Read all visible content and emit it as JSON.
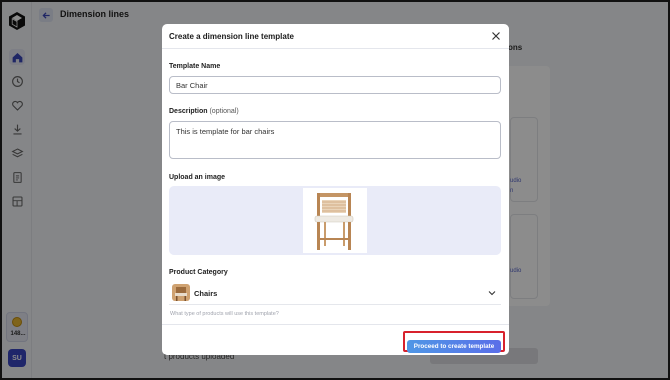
{
  "app": {
    "page_title": "Dimension lines",
    "credits_count": "148...",
    "user_initials": "SU"
  },
  "sidebar": {
    "items": [
      {
        "icon": "home-icon",
        "active": true
      },
      {
        "icon": "clock-icon",
        "active": false
      },
      {
        "icon": "heart-icon",
        "active": false
      },
      {
        "icon": "download-icon",
        "active": false
      },
      {
        "icon": "layers-icon",
        "active": false
      },
      {
        "icon": "document-icon",
        "active": false
      },
      {
        "icon": "grid-icon",
        "active": false
      }
    ]
  },
  "background": {
    "heading_fragment": "ons",
    "link_fragment_1": "udio",
    "link_fragment_2": "n",
    "link_fragment_3": "udio",
    "footer_text_fragment": "t products uploaded"
  },
  "modal": {
    "title": "Create a dimension line template",
    "template_name_label": "Template Name",
    "template_name_value": "Bar Chair",
    "description_label": "Description",
    "description_optional": "(optional)",
    "description_value": "This is template for bar chairs",
    "upload_label": "Upload an image",
    "category_label": "Product Category",
    "category_value": "Chairs",
    "category_help": "What type of products will use this template?",
    "submit_label": "Proceed to create template"
  },
  "colors": {
    "accent_start": "#4f97e6",
    "accent_end": "#5a6ee8",
    "highlight_border": "#d8212c",
    "avatar": "#3a46c2"
  }
}
